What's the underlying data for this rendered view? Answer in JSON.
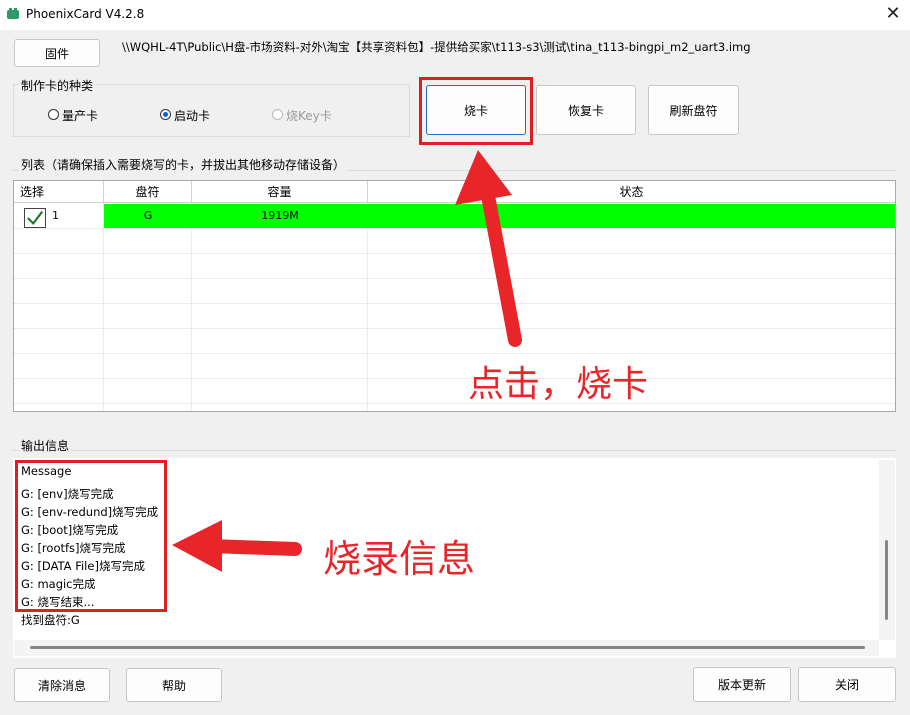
{
  "window": {
    "title": "PhoenixCard V4.2.8"
  },
  "toolbar": {
    "firmware_button": "固件",
    "image_path": "\\\\WQHL-4T\\Public\\H盘-市场资料-对外\\淘宝【共享资料包】-提供给买家\\t113-s3\\测试\\tina_t113-bingpi_m2_uart3.img"
  },
  "card_type": {
    "group_label": "制作卡的种类",
    "options": [
      {
        "label": "量产卡",
        "selected": false,
        "enabled": true
      },
      {
        "label": "启动卡",
        "selected": true,
        "enabled": true
      },
      {
        "label": "烧Key卡",
        "selected": false,
        "enabled": false
      }
    ]
  },
  "actions": {
    "burn": "烧卡",
    "restore": "恢复卡",
    "refresh": "刷新盘符"
  },
  "list": {
    "group_label": "列表（请确保插入需要烧写的卡，并拔出其他移动存储设备）",
    "columns": [
      "选择",
      "盘符",
      "容量",
      "状态"
    ],
    "rows": [
      {
        "index": "1",
        "checked": true,
        "drive": "G",
        "capacity": "1919M",
        "status": "",
        "highlight": "#00ff00"
      }
    ]
  },
  "output": {
    "group_label": "输出信息",
    "lines": [
      "Message",
      "G: [env]烧写完成",
      "G: [env-redund]烧写完成",
      "G: [boot]烧写完成",
      "G: [rootfs]烧写完成",
      "G: [DATA File]烧写完成",
      "G: magic完成",
      "G: 烧写结束...",
      "找到盘符:G"
    ]
  },
  "footer": {
    "clear": "清除消息",
    "help": "帮助",
    "update": "版本更新",
    "close": "关闭"
  },
  "annotations": {
    "click_burn": "点击，烧卡",
    "burn_info": "烧录信息",
    "color": "#e8262a"
  }
}
